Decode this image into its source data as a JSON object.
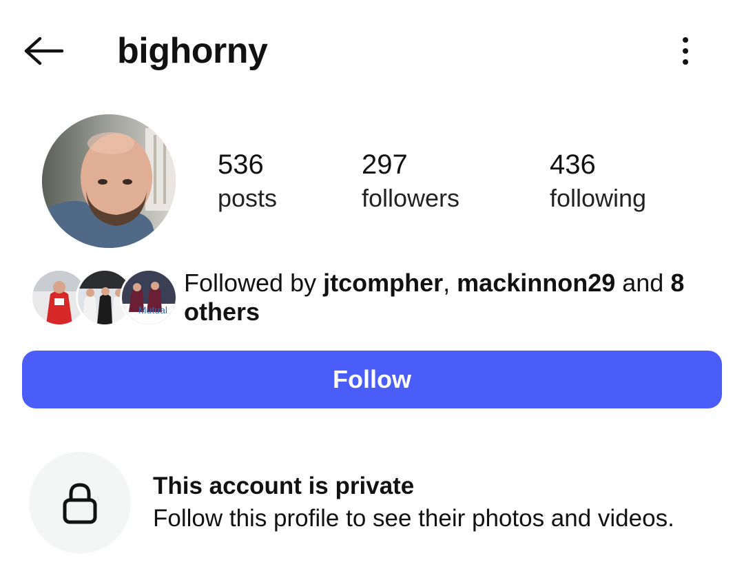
{
  "header": {
    "back_icon": "arrow-left-icon",
    "username": "bighorny",
    "menu_icon": "more-vertical-icon"
  },
  "profile": {
    "avatar_icon": "profile-photo",
    "stats": {
      "posts": {
        "count": "536",
        "label": "posts"
      },
      "followers": {
        "count": "297",
        "label": "followers"
      },
      "following": {
        "count": "436",
        "label": "following"
      }
    }
  },
  "mutuals": {
    "prefix": "Followed by ",
    "user1": "jtcompher",
    "separator": ", ",
    "user2": "mackinnon29",
    "and_text": " and ",
    "others": "8 others",
    "avatar_overlay_text": "Mutual"
  },
  "follow_button": {
    "label": "Follow",
    "color": "#4a5df9"
  },
  "private_notice": {
    "icon": "lock-icon",
    "title": "This account is private",
    "subtitle": "Follow this profile to see their photos and videos."
  }
}
